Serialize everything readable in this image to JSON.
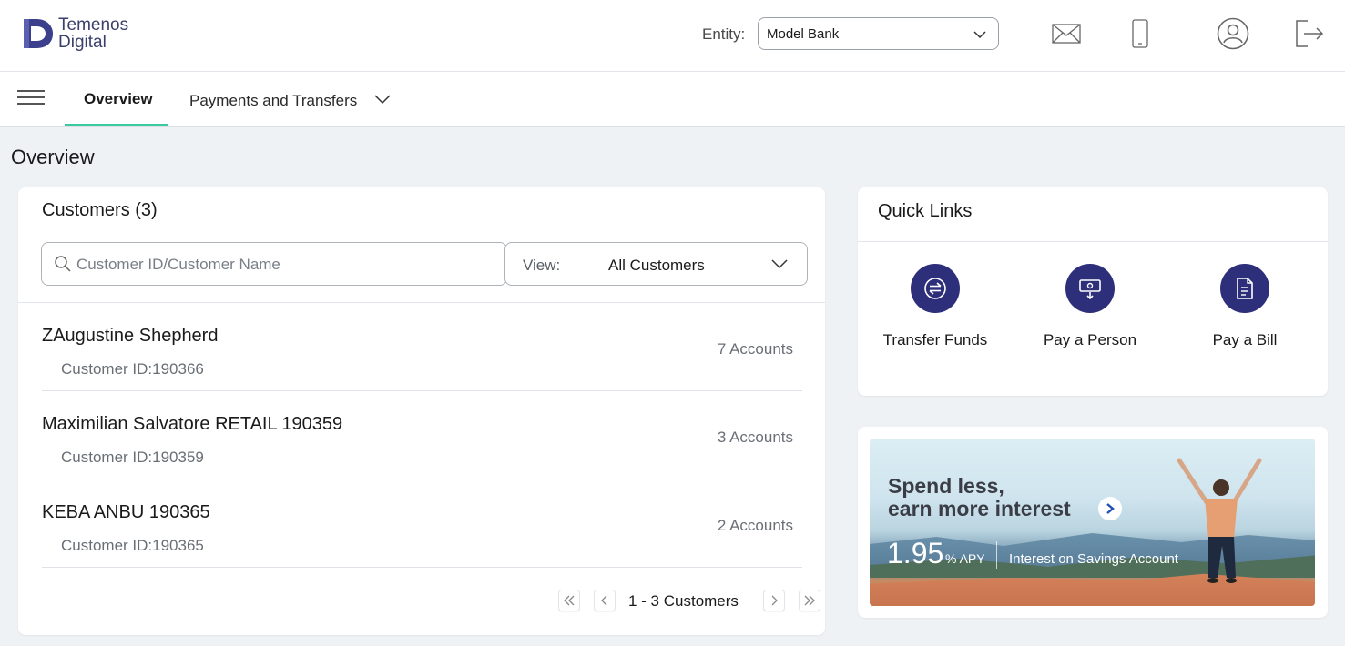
{
  "brand": {
    "name_line1": "Temenos",
    "name_line2": "Digital"
  },
  "header": {
    "entity_label": "Entity:",
    "entity_value": "Model Bank",
    "icons": [
      "mail-icon",
      "mobile-icon",
      "profile-icon",
      "logout-icon"
    ]
  },
  "nav": {
    "tabs": [
      {
        "label": "Overview",
        "active": true
      },
      {
        "label": "Payments and Transfers",
        "active": false
      }
    ]
  },
  "page": {
    "title": "Overview"
  },
  "customers": {
    "title": "Customers (3)",
    "search_placeholder": "Customer ID/Customer Name",
    "view_label": "View:",
    "view_value": "All Customers",
    "rows": [
      {
        "name": "ZAugustine Shepherd",
        "customer_id": "Customer ID:190366",
        "accounts": "7 Accounts"
      },
      {
        "name": "Maximilian Salvatore RETAIL 190359",
        "customer_id": "Customer ID:190359",
        "accounts": "3 Accounts"
      },
      {
        "name": "KEBA ANBU 190365",
        "customer_id": "Customer ID:190365",
        "accounts": "2 Accounts"
      }
    ],
    "pager_text": "1 - 3 Customers"
  },
  "quick_links": {
    "title": "Quick Links",
    "items": [
      {
        "label": "Transfer Funds",
        "icon": "transfer-icon"
      },
      {
        "label": "Pay a Person",
        "icon": "pay-person-icon"
      },
      {
        "label": "Pay a Bill",
        "icon": "bill-icon"
      }
    ]
  },
  "promo": {
    "headline_line1": "Spend less,",
    "headline_line2": "earn more interest",
    "rate": "1.95",
    "rate_unit": "% APY",
    "subtext": "Interest on Savings Account"
  },
  "colors": {
    "accent": "#3bc9a2",
    "brand": "#2e2f7a"
  }
}
